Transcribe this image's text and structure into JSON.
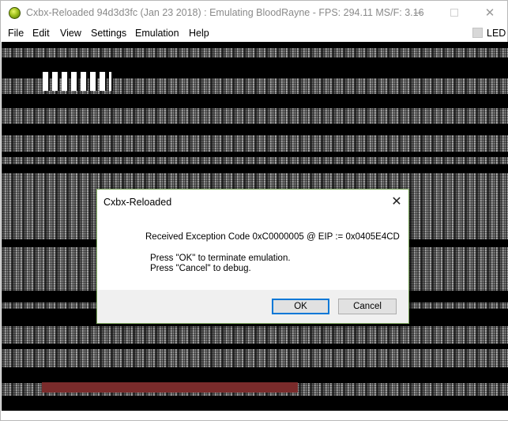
{
  "window": {
    "title": "Cxbx-Reloaded 94d3d3fc (Jan 23 2018) : Emulating BloodRayne - FPS: 294.11  MS/F: 3.16",
    "icon": "cxbx-app-icon",
    "controls": {
      "minimize": "minimize-icon",
      "maximize": "maximize-icon",
      "close": "✕"
    }
  },
  "menubar": {
    "items": [
      "File",
      "Edit",
      "View",
      "Settings",
      "Emulation",
      "Help"
    ],
    "led_label": "LED"
  },
  "dialog": {
    "title": "Cxbx-Reloaded",
    "close": "✕",
    "message": "Received Exception Code 0xC0000005 @ EIP := 0x0405E4CD",
    "line1": "Press \"OK\" to terminate emulation.",
    "line2": "Press \"Cancel\" to debug.",
    "ok_label": "OK",
    "cancel_label": "Cancel"
  },
  "colors": {
    "accent_focus": "#0078d7",
    "dialog_border": "#7ba65b",
    "render_red_bar": "#7a2b2b"
  }
}
